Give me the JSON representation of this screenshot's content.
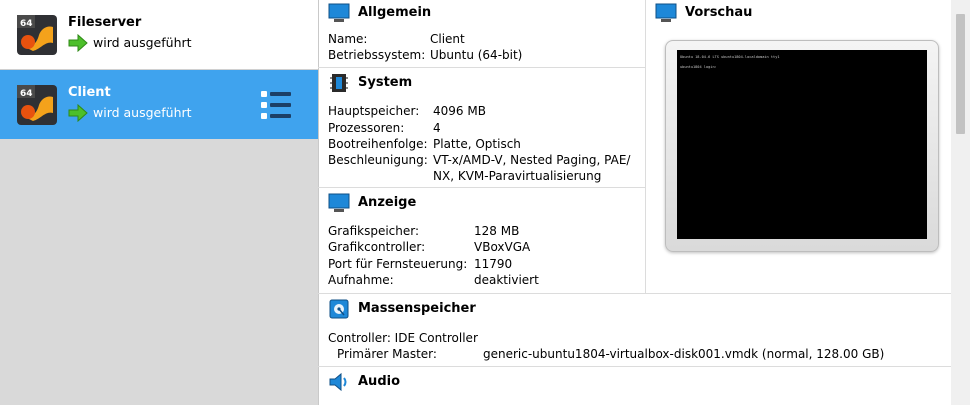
{
  "vm_list": {
    "items": [
      {
        "name": "Fileserver",
        "state": "wird ausgeführt",
        "os_badge": "64"
      },
      {
        "name": "Client",
        "state": "wird ausgeführt",
        "os_badge": "64"
      }
    ]
  },
  "details": {
    "general": {
      "title": "Allgemein",
      "rows": [
        {
          "label": "Name:",
          "value": "Client"
        },
        {
          "label": "Betriebssystem:",
          "value": "Ubuntu (64-bit)"
        }
      ]
    },
    "system": {
      "title": "System",
      "rows": [
        {
          "label": "Hauptspeicher:",
          "value": "4096 MB"
        },
        {
          "label": "Prozessoren:",
          "value": "4"
        },
        {
          "label": "Bootreihenfolge:",
          "value": "Platte, Optisch"
        },
        {
          "label": "Beschleunigung:",
          "value": "VT-x/AMD-V, Nested Paging, PAE/"
        }
      ],
      "accel_cont": "NX, KVM-Paravirtualisierung"
    },
    "display": {
      "title": "Anzeige",
      "rows": [
        {
          "label": "Grafikspeicher:",
          "value": "128 MB"
        },
        {
          "label": "Grafikcontroller:",
          "value": "VBoxVGA"
        },
        {
          "label": "Port für Fernsteuerung:",
          "value": "11790"
        },
        {
          "label": "Aufnahme:",
          "value": "deaktiviert"
        }
      ]
    },
    "storage": {
      "title": "Massenspeicher",
      "controller": "Controller: IDE Controller",
      "master_label": "Primärer Master:",
      "master_value": "generic-ubuntu1804-virtualbox-disk001.vmdk (normal, 128.00 GB)"
    },
    "audio": {
      "title": "Audio"
    },
    "preview": {
      "title": "Vorschau",
      "console_line1": "Ubuntu 18.04.6 LTS ubuntu1804.localdomain tty1",
      "console_line2": "ubuntu1804 login:"
    }
  },
  "colors": {
    "selection": "#3fa3ee",
    "list_bg": "#d9d9d9",
    "running_arrow": "#4cbf2a"
  },
  "icons": {
    "vm_os": "ubuntu-64-icon",
    "running": "green-arrow-icon",
    "vm_menu": "details-list-icon",
    "general": "monitor-icon",
    "system": "chip-icon",
    "display": "monitor-icon",
    "storage": "disk-icon",
    "audio": "speaker-icon",
    "preview": "monitor-icon"
  }
}
